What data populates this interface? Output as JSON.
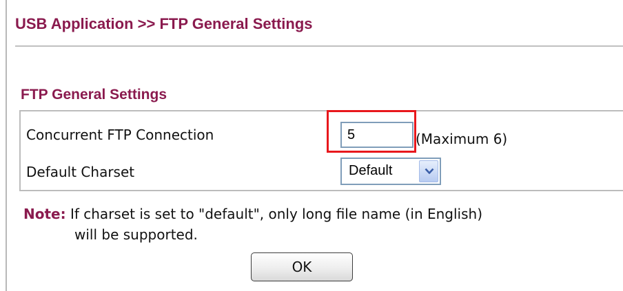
{
  "page": {
    "title": "USB Application >> FTP General Settings"
  },
  "section": {
    "title": "FTP General Settings"
  },
  "settings": {
    "concurrent_label": "Concurrent FTP Connection",
    "concurrent_value": "5",
    "concurrent_hint": "(Maximum 6)",
    "charset_label": "Default Charset",
    "charset_selected": "Default"
  },
  "note": {
    "label": "Note:",
    "text_line1": " If charset is set to \"default\", only long file name (in English)",
    "text_line2": "will be supported."
  },
  "buttons": {
    "ok_label": "OK"
  },
  "colors": {
    "heading": "#8a1a4e",
    "highlight": "#e8171c",
    "border": "#bcbcbc"
  },
  "icons": {
    "dropdown": "chevron-down-icon"
  }
}
